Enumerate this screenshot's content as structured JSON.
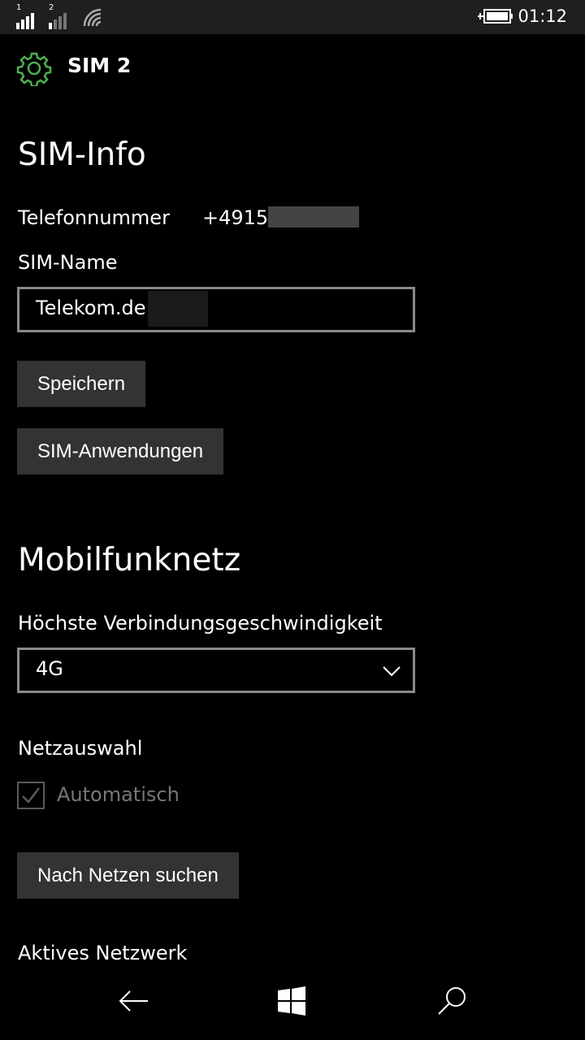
{
  "status_bar": {
    "sim1_label": "1",
    "sim2_label": "2",
    "time": "01:12"
  },
  "header": {
    "title": "SIM 2",
    "icon": "gear-icon",
    "accent_color": "#4CAF50"
  },
  "sim_info": {
    "heading": "SIM-Info",
    "phone_label": "Telefonnummer",
    "phone_value": "+49151",
    "sim_name_label": "SIM-Name",
    "sim_name_value": "Telekom.de",
    "save_label": "Speichern",
    "sim_apps_label": "SIM-Anwendungen"
  },
  "mobile_network": {
    "heading": "Mobilfunknetz",
    "speed_label": "Höchste Verbindungsgeschwindigkeit",
    "speed_value": "4G",
    "network_select_label": "Netzauswahl",
    "automatic_label": "Automatisch",
    "automatic_checked": true,
    "search_label": "Nach Netzen suchen",
    "active_network_label": "Aktives Netzwerk"
  },
  "nav": {
    "back_icon": "back-arrow-icon",
    "home_icon": "windows-icon",
    "search_icon": "search-icon"
  }
}
